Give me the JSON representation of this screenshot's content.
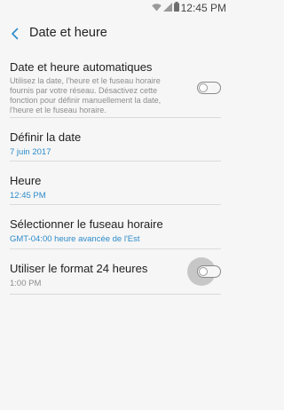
{
  "status_bar": {
    "time": "12:45 PM",
    "icons": [
      "wifi-icon",
      "signal-icon",
      "battery-icon"
    ]
  },
  "app_bar": {
    "title": "Date et heure",
    "back_icon": "chevron-left-icon"
  },
  "settings": [
    {
      "title": "Date et heure automatiques",
      "description": "Utilisez la date, l'heure et le fuseau horaire fournis par votre réseau. Désactivez cette fonction pour définir manuellement la date, l'heure et le fuseau horaire.",
      "toggle": "off"
    },
    {
      "title": "Définir la date",
      "value": "7 juin 2017"
    },
    {
      "title": "Heure",
      "value": "12:45 PM"
    },
    {
      "title": "Sélectionner le fuseau horaire",
      "value": "GMT-04:00 heure avancée de l'Est"
    },
    {
      "title": "Utiliser le format 24 heures",
      "value": "1:00 PM",
      "toggle": "off"
    }
  ],
  "colors": {
    "background": "#f6f6f6",
    "accent": "#2c8bc9",
    "divider": "#dadada"
  }
}
